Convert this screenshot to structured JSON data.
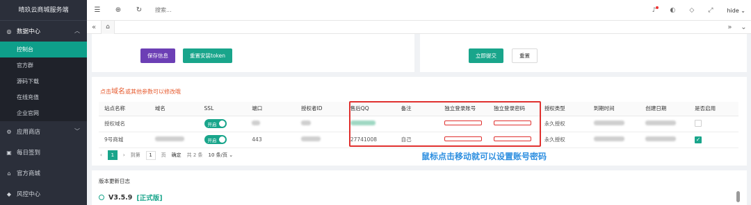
{
  "sidebar": {
    "brand": "晴玖云商城服务端",
    "groups": [
      {
        "label": "数据中心",
        "icon": "chart-icon"
      },
      {
        "label": "应用商店",
        "icon": "store-icon"
      },
      {
        "label": "每日签到",
        "icon": "calendar-icon"
      },
      {
        "label": "官方商城",
        "icon": "cart-icon"
      },
      {
        "label": "风控中心",
        "icon": "shield-icon"
      }
    ],
    "items": [
      {
        "label": "控制台",
        "active": true
      },
      {
        "label": "官方群"
      },
      {
        "label": "源码下载"
      },
      {
        "label": "在线充值"
      },
      {
        "label": "企业官网"
      }
    ]
  },
  "topbar": {
    "search_placeholder": "搜索...",
    "user": "hide"
  },
  "form_a": {
    "save_label": "保存信息",
    "reset_token_label": "重置安装token"
  },
  "form_b": {
    "submit_label": "立即提交",
    "reset_label": "重置"
  },
  "sites": {
    "hint_prefix": "点击",
    "hint_emph": "域名",
    "hint_suffix": "或其他参数可以修改哦",
    "columns": [
      "站点名称",
      "域名",
      "SSL",
      "端口",
      "授权者ID",
      "售后QQ",
      "备注",
      "独立登录账号",
      "独立登录密码",
      "授权类型",
      "到期时间",
      "创建日期",
      "是否启用"
    ],
    "rows": [
      {
        "name": "授权域名",
        "ssl": "开启",
        "port": "",
        "qq": "",
        "note": "",
        "license": "永久授权",
        "enabled": false
      },
      {
        "name": "9号商城",
        "ssl": "开启",
        "port": "443",
        "qq": "27741008",
        "note": "自己",
        "license": "永久授权",
        "enabled": true
      }
    ],
    "pager": {
      "prev": "‹",
      "current": "1",
      "next": "›",
      "goto_label": "到第",
      "goto_value": "1",
      "page_label": "页",
      "confirm": "确定",
      "total": "共 2 条",
      "per_page": "10 条/页"
    },
    "annotation": "鼠标点击移动就可以设置账号密码"
  },
  "changelog": {
    "title": "版本更新日志",
    "version": "V3.5.9",
    "tag": "[正式版]"
  },
  "colors": {
    "accent": "#19a58b",
    "purple": "#6c3fb5",
    "highlight": "#e0302e",
    "annotation": "#2e8fe0"
  }
}
